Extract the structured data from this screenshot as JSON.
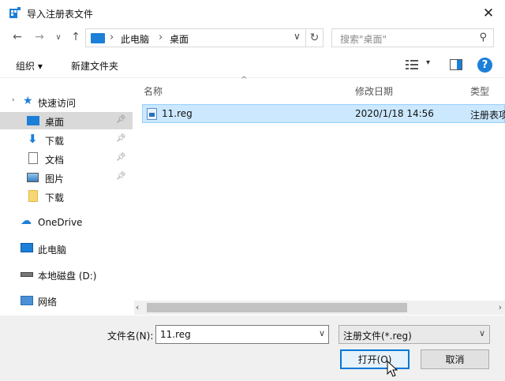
{
  "window": {
    "title": "导入注册表文件",
    "close_glyph": "✕"
  },
  "navigation": {
    "breadcrumb": [
      "此电脑",
      "桌面"
    ],
    "search_placeholder": "搜索\"桌面\""
  },
  "toolbar": {
    "organize_label": "组织 ▾",
    "new_folder_label": "新建文件夹"
  },
  "sidebar": {
    "items": [
      {
        "label": "快速访问",
        "icon": "star-icon"
      },
      {
        "label": "桌面",
        "icon": "desktop-icon",
        "selected": true,
        "pinned": true
      },
      {
        "label": "下载",
        "icon": "download-icon",
        "pinned": true
      },
      {
        "label": "文档",
        "icon": "document-icon",
        "pinned": true
      },
      {
        "label": "图片",
        "icon": "picture-icon",
        "pinned": true
      },
      {
        "label": "下载",
        "icon": "folder-icon"
      },
      {
        "label": "OneDrive",
        "icon": "cloud-icon"
      },
      {
        "label": "此电脑",
        "icon": "computer-icon"
      },
      {
        "label": "本地磁盘 (D:)",
        "icon": "drive-icon"
      },
      {
        "label": "网络",
        "icon": "network-icon"
      }
    ]
  },
  "file_list": {
    "columns": [
      "名称",
      "修改日期",
      "类型"
    ],
    "rows": [
      {
        "name": "11.reg",
        "modified": "2020/1/18 14:56",
        "type": "注册表项"
      }
    ]
  },
  "footer": {
    "filename_label": "文件名(N):",
    "filename_value": "11.reg",
    "filetype_value": "注册文件(*.reg)",
    "open_label": "打开(O)",
    "cancel_label": "取消"
  },
  "colors": {
    "accent": "#0078d7",
    "selection": "#cce8ff",
    "folder_blue": "#1c7fd8"
  }
}
